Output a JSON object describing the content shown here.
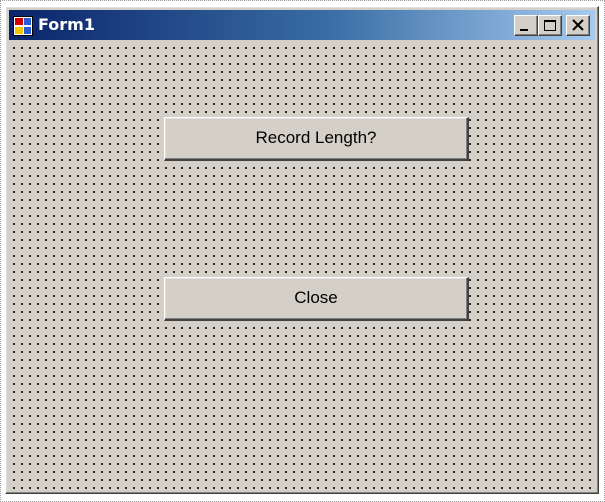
{
  "window": {
    "title": "Form1",
    "icon": "form-icon",
    "caption_buttons": [
      "minimize-icon",
      "maximize-icon",
      "close-icon"
    ]
  },
  "form": {
    "buttons": {
      "record_length_label": "Record Length?",
      "close_label": "Close"
    }
  },
  "colors": {
    "title_gradient_start": "#0a246a",
    "title_gradient_end": "#a6caf0",
    "form_background": "#d4d0c8",
    "grid_dot": "#000000"
  }
}
